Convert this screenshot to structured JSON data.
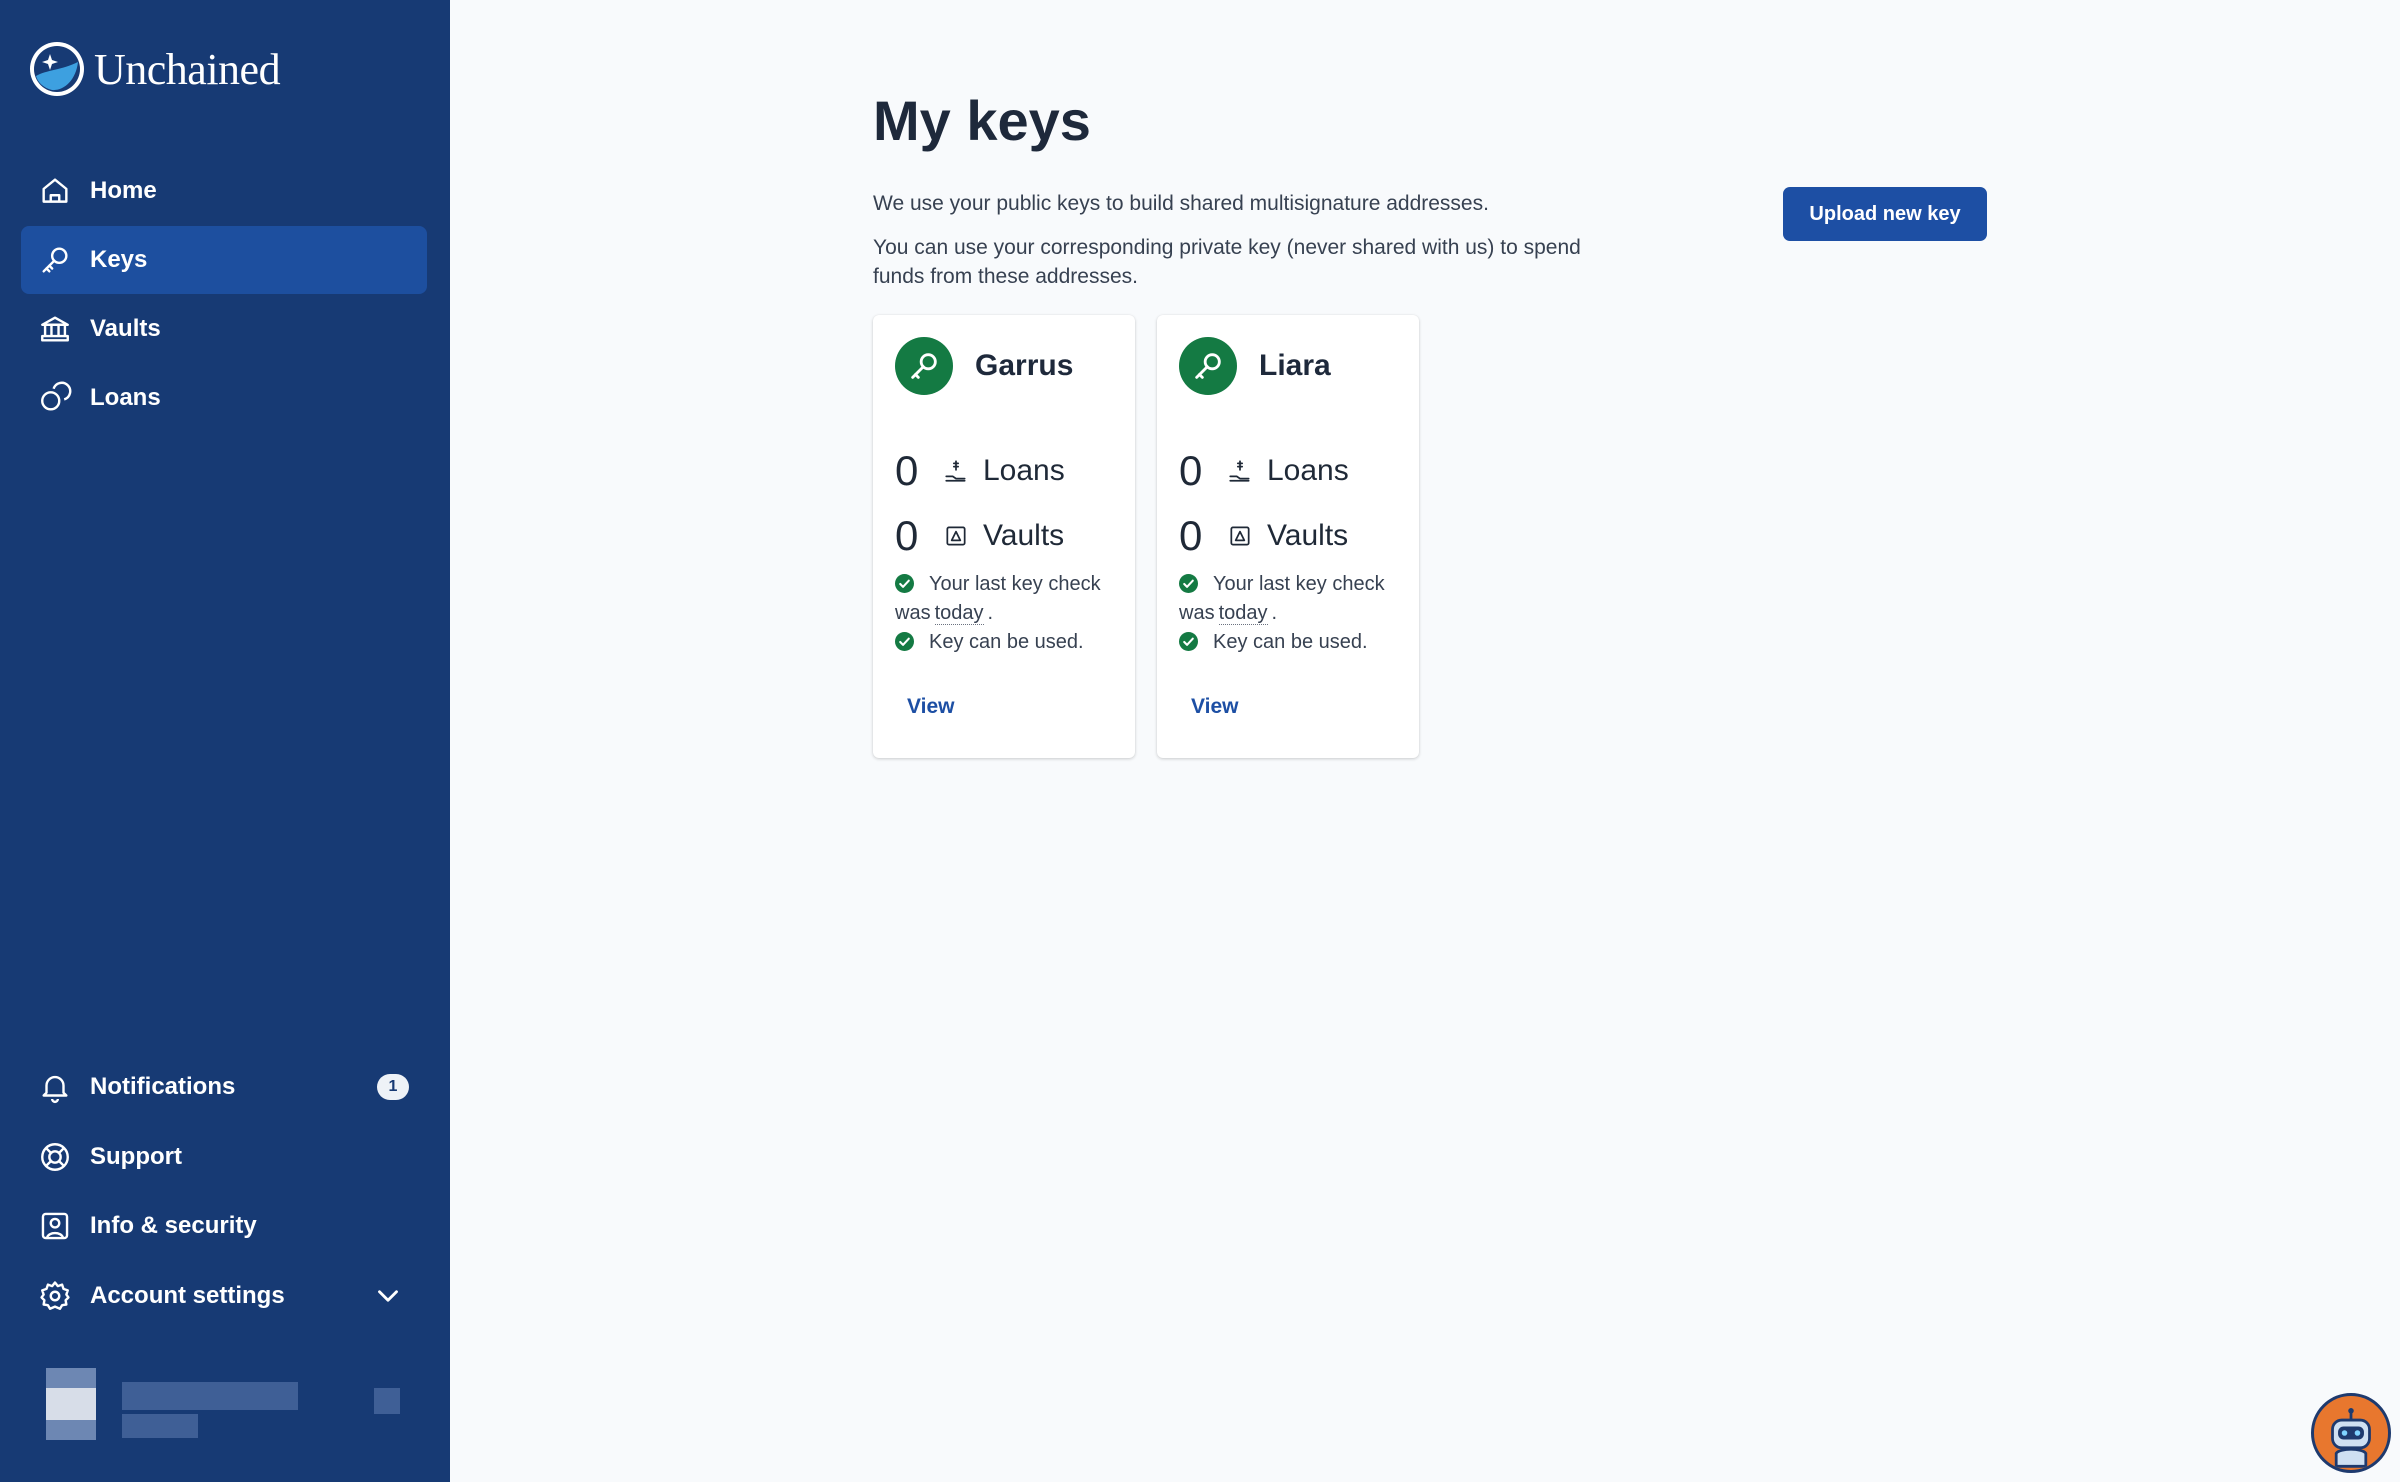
{
  "brand": {
    "name": "Unchained"
  },
  "sidebar": {
    "nav": [
      {
        "label": "Home",
        "icon": "home-icon"
      },
      {
        "label": "Keys",
        "icon": "key-icon",
        "active": true
      },
      {
        "label": "Vaults",
        "icon": "bank-icon"
      },
      {
        "label": "Loans",
        "icon": "coins-icon"
      }
    ],
    "bottom": [
      {
        "label": "Notifications",
        "icon": "bell-icon",
        "badge": "1"
      },
      {
        "label": "Support",
        "icon": "lifebuoy-icon"
      },
      {
        "label": "Info & security",
        "icon": "user-badge-icon"
      },
      {
        "label": "Account settings",
        "icon": "gear-icon"
      }
    ]
  },
  "main": {
    "title": "My keys",
    "description_1": "We use your public keys to build shared multisignature addresses.",
    "description_2": "You can use your corresponding private key (never shared with us) to spend funds from these addresses.",
    "upload_label": "Upload new key"
  },
  "keys": [
    {
      "name": "Garrus",
      "loans_count": "0",
      "loans_label": "Loans",
      "vaults_count": "0",
      "vaults_label": "Vaults",
      "last_check_prefix": "Your last key check was",
      "last_check_value": "today",
      "last_check_suffix": ".",
      "usable_text": "Key can be used.",
      "view_label": "View"
    },
    {
      "name": "Liara",
      "loans_count": "0",
      "loans_label": "Loans",
      "vaults_count": "0",
      "vaults_label": "Vaults",
      "last_check_prefix": "Your last key check was",
      "last_check_value": "today",
      "last_check_suffix": ".",
      "usable_text": "Key can be used.",
      "view_label": "View"
    }
  ],
  "colors": {
    "sidebar_bg": "#173a74",
    "active_item": "#1d4f9f",
    "primary": "#1d4fa4",
    "success": "#147a43"
  }
}
